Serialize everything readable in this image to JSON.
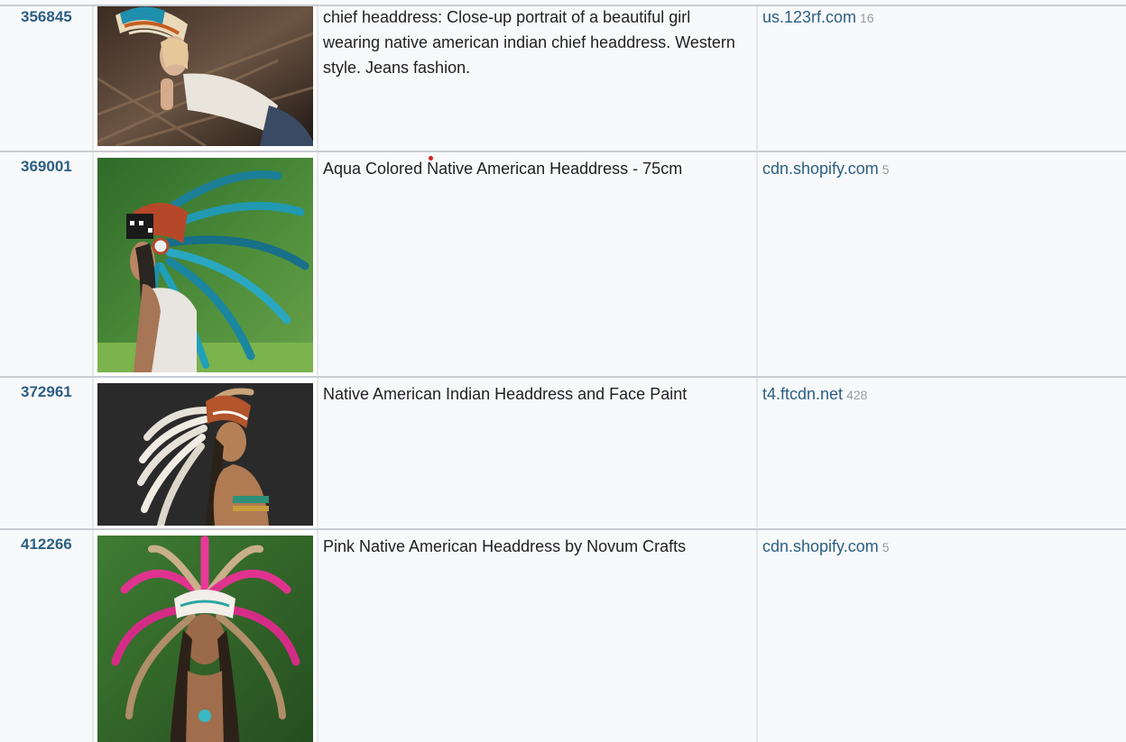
{
  "rows": [
    {
      "id": "356845",
      "image_subject": "girl-wearing-headdress-lying-on-wood",
      "caption": "chief headdress: Close-up portrait of a beautiful girl wearing native american indian chief headdress. Western style. Jeans fashion.",
      "domain": "us.123rf.com",
      "count": "16"
    },
    {
      "id": "369001",
      "image_subject": "aqua-feather-headdress-profile",
      "caption": "Aqua Colored Native American Headdress - 75cm",
      "domain": "cdn.shopify.com",
      "count": "5"
    },
    {
      "id": "372961",
      "image_subject": "woman-with-headdress-and-face-paint",
      "caption": "Native American Indian Headdress and Face Paint",
      "domain": "t4.ftcdn.net",
      "count": "428"
    },
    {
      "id": "412266",
      "image_subject": "pink-feather-headdress-front",
      "caption": "Pink Native American Headdress by Novum Crafts",
      "domain": "cdn.shopify.com",
      "count": "5"
    }
  ],
  "colors": {
    "link": "#2b5f82",
    "text": "#222222",
    "muted": "#9a9a9a",
    "row_bg": "#f8f9fb",
    "border": "#c9ccd1"
  }
}
